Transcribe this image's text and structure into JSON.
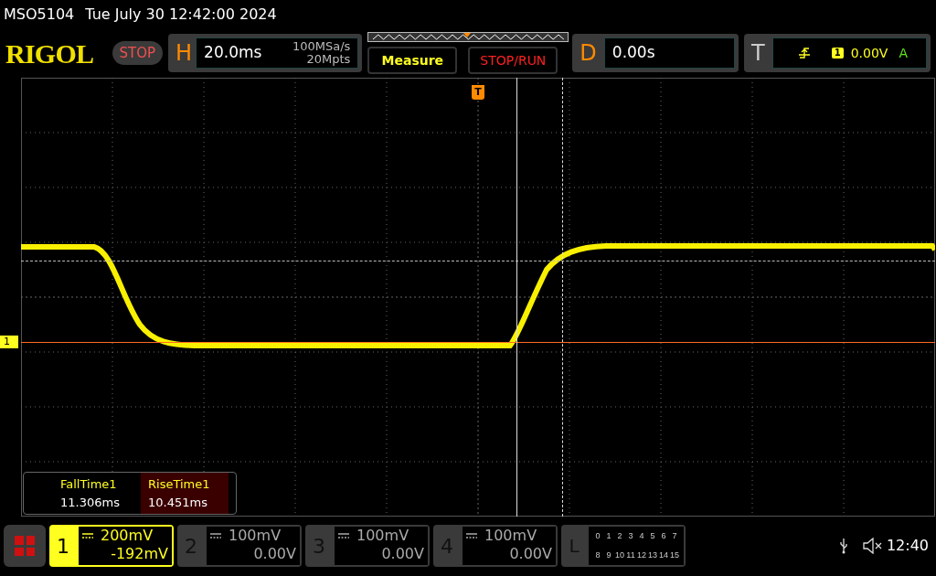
{
  "header": {
    "model": "MSO5104",
    "datetime": "Tue July 30 12:42:00 2024"
  },
  "logo": "RIGOL",
  "run_state": "STOP",
  "horizontal": {
    "label": "H",
    "timebase": "20.0ms",
    "sample_rate": "100MSa/s",
    "memory_depth": "20Mpts"
  },
  "buttons": [
    {
      "label": "Measure",
      "kind": "measure"
    },
    {
      "label": "STOP/RUN",
      "kind": "run"
    }
  ],
  "delay": {
    "label": "D",
    "value": "0.00s"
  },
  "trigger": {
    "label": "T",
    "source": "1",
    "level": "0.00V",
    "mode": "A"
  },
  "graticule": {
    "trigger_marker": "T",
    "channel_marker": "1"
  },
  "measurements": [
    {
      "name": "FallTime1",
      "value": "11.306ms",
      "selected": false
    },
    {
      "name": "RiseTime1",
      "value": "10.451ms",
      "selected": true
    }
  ],
  "channels": [
    {
      "number": "1",
      "scale": "200mV",
      "offset": "-192mV",
      "active": true
    },
    {
      "number": "2",
      "scale": "100mV",
      "offset": "0.00V",
      "active": false
    },
    {
      "number": "3",
      "scale": "100mV",
      "offset": "0.00V",
      "active": false
    },
    {
      "number": "4",
      "scale": "100mV",
      "offset": "0.00V",
      "active": false
    }
  ],
  "logic": {
    "label": "L",
    "bits": [
      "0",
      "1",
      "2",
      "3",
      "4",
      "5",
      "6",
      "7",
      "8",
      "9",
      "10",
      "11",
      "12",
      "13",
      "14",
      "15"
    ]
  },
  "status": {
    "time": "12:40"
  }
}
